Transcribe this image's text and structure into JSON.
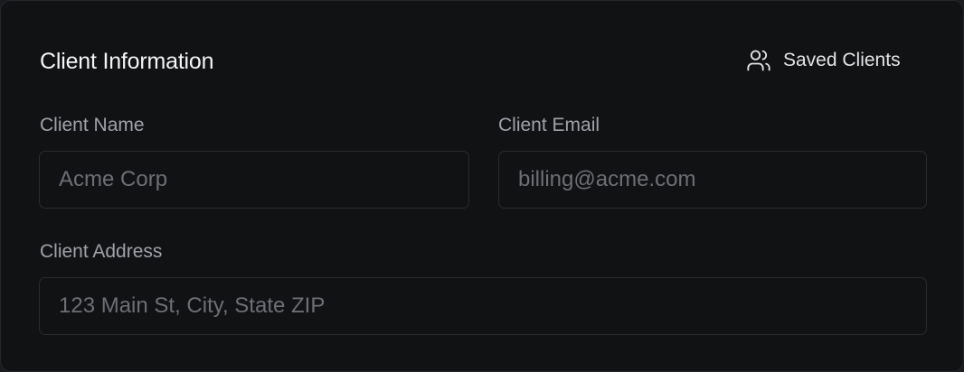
{
  "section": {
    "title": "Client Information",
    "saved_clients_label": "Saved Clients",
    "saved_clients_icon": "users-icon"
  },
  "fields": {
    "client_name": {
      "label": "Client Name",
      "value": "",
      "placeholder": "Acme Corp"
    },
    "client_email": {
      "label": "Client Email",
      "value": "",
      "placeholder": "billing@acme.com"
    },
    "client_address": {
      "label": "Client Address",
      "value": "",
      "placeholder": "123 Main St, City, State ZIP"
    }
  },
  "colors": {
    "background": "#111214",
    "border": "#2a2b30",
    "text_primary": "#f4f4f5",
    "text_label": "#a1a1aa",
    "placeholder": "#6e6e76"
  }
}
